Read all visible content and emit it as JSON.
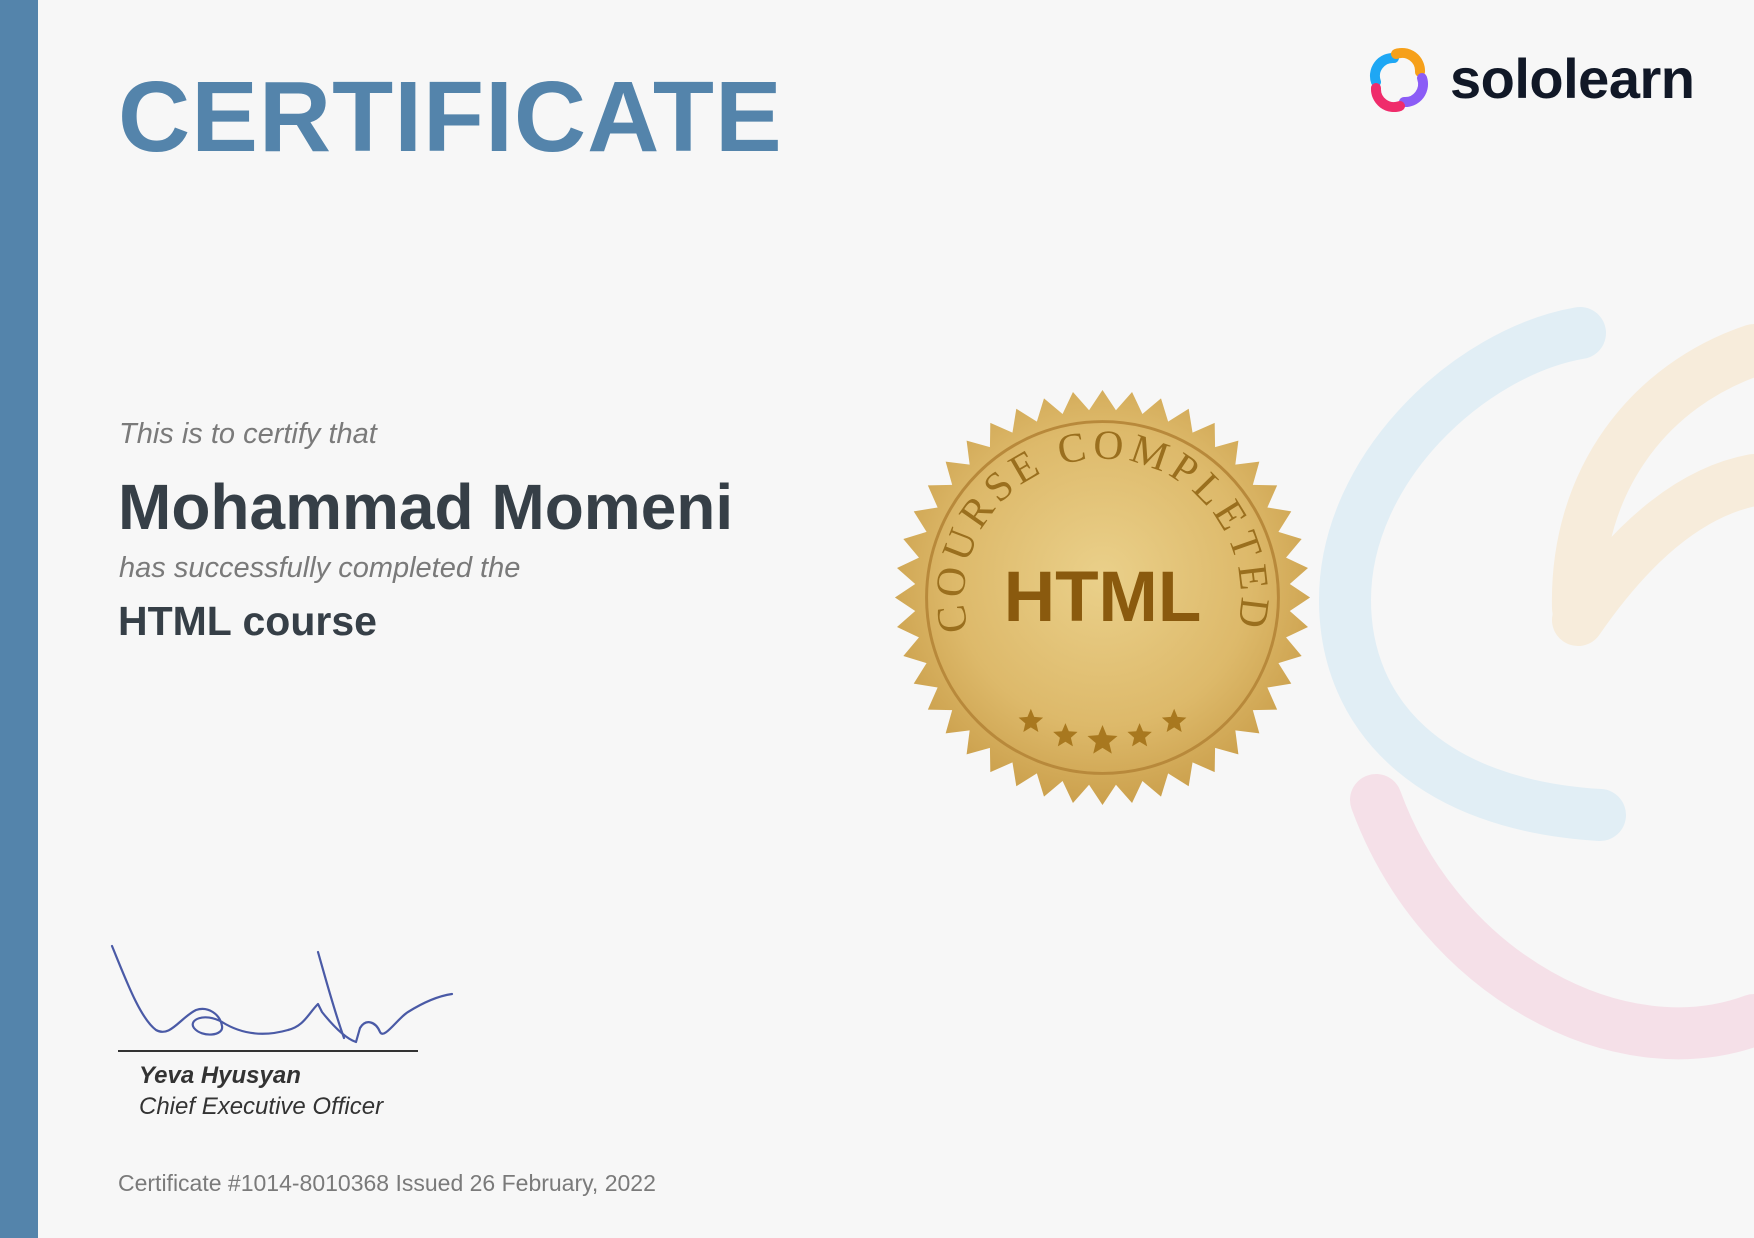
{
  "certificate": {
    "title": "CERTIFICATE",
    "brand": "sololearn",
    "certify_text": "This is to certify that",
    "recipient_name": "Mohammad Momeni",
    "completed_text": "has successfully completed the",
    "course_name": "HTML course",
    "seal": {
      "arc_text": "COURSE COMPLETED",
      "center_text": "HTML",
      "stars": 5
    },
    "signer": {
      "name": "Yeva Hyusyan",
      "title": "Chief Executive Officer"
    },
    "footer_text": "Certificate #1014-8010368 Issued 26 February, 2022"
  },
  "colors": {
    "accent": "#5484ab",
    "text_dark": "#363f47",
    "text_muted": "#7a7a7a",
    "seal_gold": "#d8b463",
    "seal_text": "#8a5a0e"
  }
}
